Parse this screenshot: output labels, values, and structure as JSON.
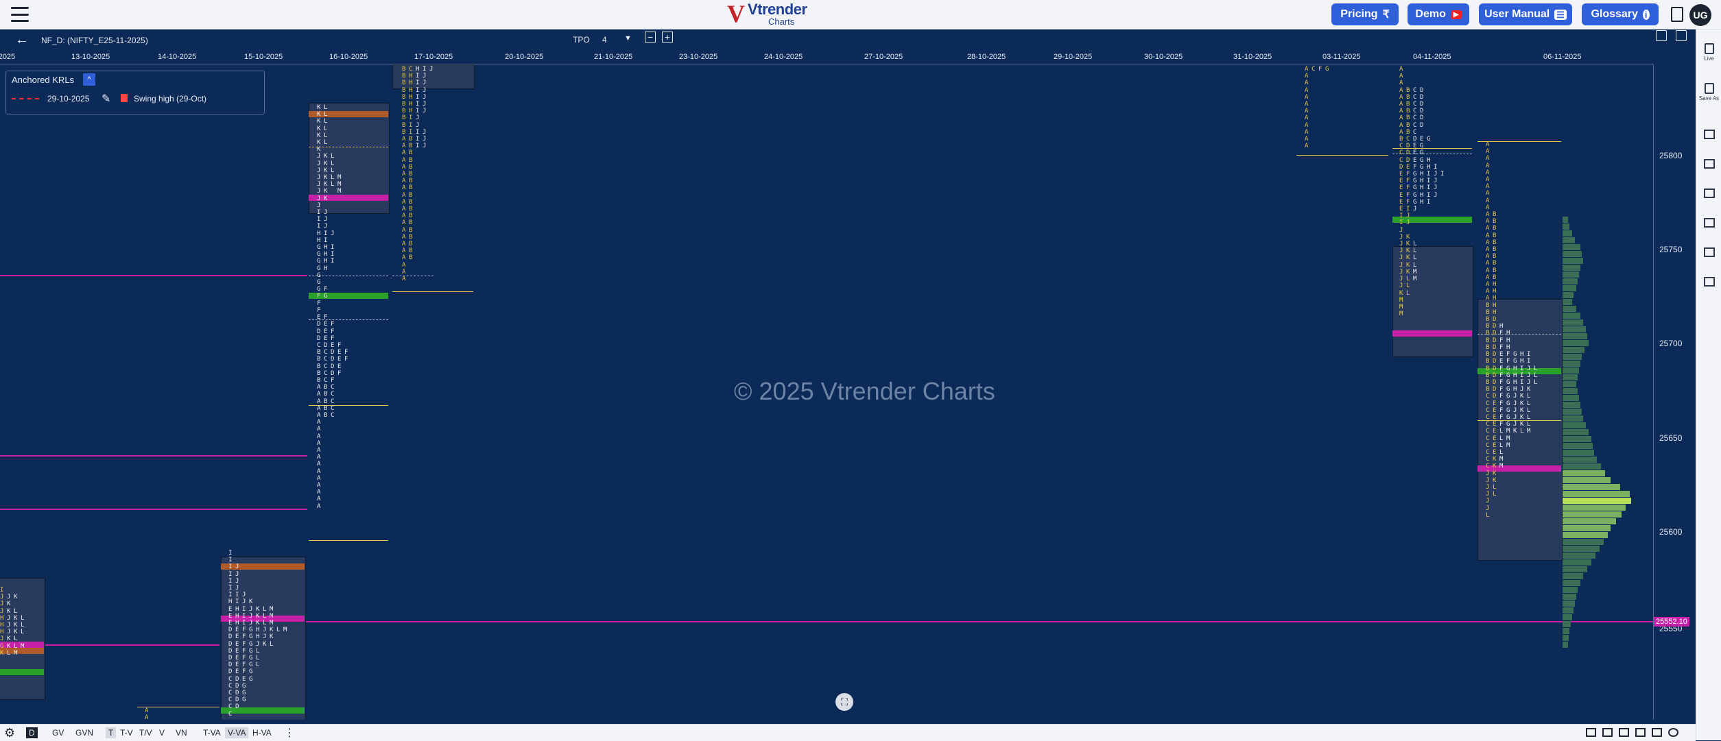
{
  "header": {
    "menu_icon": "hamburger-icon",
    "logo": {
      "mark": "V",
      "brand": "Vtrender",
      "sub": "Charts"
    },
    "buttons": [
      {
        "label": "Pricing",
        "icon": "₹",
        "icon_name": "rupee-icon"
      },
      {
        "label": "Demo",
        "icon": "▶",
        "icon_name": "youtube-icon"
      },
      {
        "label": "User Manual",
        "icon": "☰",
        "icon_name": "manual-icon"
      },
      {
        "label": "Glossary",
        "icon": "i",
        "icon_name": "info-icon"
      }
    ],
    "avatar": "UG",
    "accent": "#2f5fd9"
  },
  "chart": {
    "symbol": "NF_D: (NIFTY_E25-11-2025)",
    "tpo_label": "TPO",
    "tpo_value": "4",
    "dates": [
      "-2025",
      "13-10-2025",
      "14-10-2025",
      "15-10-2025",
      "16-10-2025",
      "17-10-2025",
      "20-10-2025",
      "21-10-2025",
      "23-10-2025",
      "24-10-2025",
      "27-10-2025",
      "28-10-2025",
      "29-10-2025",
      "30-10-2025",
      "31-10-2025",
      "03-11-2025",
      "04-11-2025",
      "06-11-2025"
    ],
    "price_labels": [
      "25800",
      "25750",
      "25700",
      "25650",
      "25600",
      "25550"
    ],
    "last_price": "25552.10",
    "watermark": "© 2025 Vtrender Charts",
    "colors": {
      "poc": "#c81fa8",
      "va_band": "#2aa12a",
      "ib_band": "#b05a2a",
      "bg": "#0c2a57",
      "profile": "#3a6e55"
    }
  },
  "krl": {
    "title": "Anchored KRLs",
    "collapse": "^",
    "date": "29-10-2025",
    "name": "Swing high (29-Oct)"
  },
  "profiles": [
    {
      "id": "p1",
      "cols": [
        {
          "c": "y",
          "t": "I\nJ\nJ\nJ\nH\nH\nH\nJ\nG\nK"
        },
        {
          "c": "w",
          "t": "\nJ\nK\nK\nJ\nJ\nJ\nK\nK\nL"
        },
        {
          "c": "w",
          "t": "\nK\n\nL\nK\nK\nK\nL\nL\nM"
        },
        {
          "c": "w",
          "t": "\n\n\n\nL\nL\nL\n\nM"
        }
      ]
    },
    {
      "id": "p2",
      "cols": [
        {
          "c": "y",
          "t": "A\nA"
        }
      ]
    },
    {
      "id": "p3",
      "cols": [
        {
          "c": "w",
          "t": "I\nI\nI\nI\nI\nI\nI\nH\nE\nE\nE\nD\nD\nD\nD\nD\nD\nD\nC\nC\nC\nC\nC\nC"
        },
        {
          "c": "w",
          "t": "\n\nJ\nJ\nJ\nJ\nI\nI\nH\nH\nH\nE\nE\nE\nE\nE\nE\nE\nD\nD\nD\nD\nD"
        },
        {
          "c": "w",
          "t": "\n\n\n\n\n\nJ\nJ\nI\nI\nI\nF\nF\nF\nF\nF\nF\nF\nE\nG\nG\nG"
        },
        {
          "c": "w",
          "t": "\n\n\n\n\n\n\nK\nJ\nJ\nJ\nG\nG\nG\nG\nG\nG\nG\nG"
        },
        {
          "c": "w",
          "t": "\n\n\n\n\n\n\n\nK\nK\nK\nH\nH\nJ\nL\nL\nL"
        },
        {
          "c": "w",
          "t": "\n\n\n\n\n\n\n\nL\nL\nL\nJ\nJ\nK"
        },
        {
          "c": "w",
          "t": "\n\n\n\n\n\n\n\nM\nM\nM\nK\nK\nL"
        },
        {
          "c": "w",
          "t": "\n\n\n\n\n\n\n\n\n\n\nL"
        },
        {
          "c": "w",
          "t": "\n\n\n\n\n\n\n\n\n\n\nM"
        }
      ]
    },
    {
      "id": "p4",
      "cols": [
        {
          "c": "w",
          "t": "K\nK\nK\nK\nK\nK\nK\nJ\nJ\nJ\nJ\nJ\nJ\nJ\nJ\nI\nI\nI\nH\nH\nG\nG\nG\nG\nG\nG\nG\nF\nF\nF\nE\nD\nD\nD\nC\nB\nB\nB\nB\nB\nA\nA\nA\nA\nA\nA\nA\nA\nA\nA\nA\nA\nA\nA\nA\nA\nA\nA"
        },
        {
          "c": "w",
          "t": "L\nL\nL\nL\nL\nL\n\nK\nK\nK\nK\nK\nK\nK\n\nJ\nJ\nJ\nI\nI\nH\nH\nH\nH\n\n\nF\nG\n\n\nF\nE\nE\nE\nD\nC\nC\nC\nC\nC\nB\nB\nB\nB\nB"
        },
        {
          "c": "w",
          "t": "\n\n\n\n\n\n\nL\nL\nL\nL\nL\n\n\n\n\n\n\nJ\n\nI\nI\nI\n\n\n\n\n\n\n\n\nF\nF\nF\nE\nD\nD\nD\nD\nF\nC\nC\nC\nC\nC"
        },
        {
          "c": "w",
          "t": "\n\n\n\n\n\n\n\n\n\nM\nM\nM\n\n\n\n\n\n\n\n\n\n\n\n\n\n\n\n\n\n\n\n\n\nF\nE\nE\nE\nF"
        },
        {
          "c": "w",
          "t": "\n\n\n\n\n\n\n\n\n\n\n\n\n\n\n\n\n\n\n\n\n\n\n\n\n\n\n\n\n\n\n\n\n\n\nF\nF"
        }
      ]
    },
    {
      "id": "p5",
      "cols": [
        {
          "c": "y",
          "t": "B\nB\nB\nB\nB\nB\nB\nB\nB\nB\nA\nA\nA\nA\nA\nA\nA\nA\nA\nA\nA\nA\nA\nA\nA\nA\nA\nA\nA\nA\nA"
        },
        {
          "c": "y",
          "t": "C\nH\nH\nH\nH\nH\nH\nI\nI\nI\nB\nB\nB\nB\nB\nB\nB\nB\nB\nB\nB\nB\nB\nB\nB\nB\nB\nB"
        },
        {
          "c": "w",
          "t": "H\nI\nI\nI\nI\nI\nI\nJ\nJ\nI\nI\nI"
        },
        {
          "c": "w",
          "t": "I\nJ\nJ\nJ\nJ\nJ\nJ\n\n\nJ\nJ\nJ"
        },
        {
          "c": "w",
          "t": "J"
        }
      ]
    },
    {
      "id": "p6",
      "cols": [
        {
          "c": "y",
          "t": "A\nA\nA\nA\nA\nA\nA\nA\nA\nA\nA\nA"
        },
        {
          "c": "y",
          "t": "C"
        },
        {
          "c": "y",
          "t": "F"
        },
        {
          "c": "y",
          "t": "G"
        }
      ]
    },
    {
      "id": "p7",
      "cols": [
        {
          "c": "y",
          "t": "A\nA\nA\nA\nA\nA\nA\nA\nA\nA\nB\nC\nC\nC\nD\nE\nE\nE\nE\nE\nE\nI\nI\nJ\nJ\nJ\nJ\nJ\nJ\nJ\nJ\nJ\nK\nM\nM\nM"
        },
        {
          "c": "y",
          "t": "\n\n\nB\nB\nB\nB\nB\nB\nB\nC\nD\nD\nD\nE\nF\nF\nF\nF\nF\nI\nJ\nJ\n\nK\nK\nK\nK\nK\nK\nL\nL\nL"
        },
        {
          "c": "w",
          "t": "\n\n\nC\nC\nC\nC\nC\nC\nC\nD\nE\nE\nE\nF\nG\nG\nG\nG\nG\nJ\n\n\n\n\nL\nL\nL\nL\nM\nM"
        },
        {
          "c": "w",
          "t": "\n\n\nD\nD\nD\nD\nD\nD\n\nE\nG\nG\nG\nG\nH\nH\nH\nH\nH"
        },
        {
          "c": "w",
          "t": "\n\n\n\n\n\n\n\n\n\nG\n\n\nH\nH\nI\nI\nI\nI\nI"
        },
        {
          "c": "w",
          "t": "\n\n\n\n\n\n\n\n\n\n\n\n\n\nI\nJ\nJ\nJ\nJ"
        },
        {
          "c": "w",
          "t": "\n\n\n\n\n\n\n\n\n\n\n\n\n\n\nI"
        }
      ]
    },
    {
      "id": "p8",
      "cols": [
        {
          "c": "y",
          "t": "A\nA\nA\nA\nA\nA\nA\nA\nA\nA\nA\nA\nA\nA\nA\nA\nA\nA\nA\nA\nA\nA\nA\nB\nB\nB\nB\nB\nB\nB\nB\nB\nB\nB\nB\nB\nC\nC\nC\nC\nC\nC\nC\nC\nC\nC\nC\nJ\nJ\nJ\nJ\nJ\nJ\nL"
        },
        {
          "c": "y",
          "t": "\n\n\n\n\n\n\n\n\n\nB\nB\nB\nB\nB\nB\nB\nB\nB\nB\nH\nH\nH\nH\nH\nD\nD\nD\nD\nD\nD\nD\nD\nD\nD\nD\nD\nE\nE\nE\nE\nE\nE\nE\nE\nK\nK\nK\nK\nL\nL"
        },
        {
          "c": "w",
          "t": "\n\n\n\n\n\n\n\n\n\n\n\n\n\n\n\n\n\n\n\n\n\n\n\n\n\nH\nF\nF\nF\nE\nE\nF\nF\nF\nF\nF\nF\nF\nF\nF\nL\nL\nL\nL\nM\nM"
        },
        {
          "c": "w",
          "t": "\n\n\n\n\n\n\n\n\n\n\n\n\n\n\n\n\n\n\n\n\n\n\n\n\n\n\nH\nH\nH\nF\nF\nG\nG\nG\nG\nG\nG\nG\nG\nG\nM\nM\nM"
        },
        {
          "c": "w",
          "t": "\n\n\n\n\n\n\n\n\n\n\n\n\n\n\n\n\n\n\n\n\n\n\n\n\n\n\n\n\n\nG\nG\nH\nH\nH\nH\nJ\nJ\nJ\nJ\nJ\nK"
        },
        {
          "c": "w",
          "t": "\n\n\n\n\n\n\n\n\n\n\n\n\n\n\n\n\n\n\n\n\n\n\n\n\n\n\n\n\n\nH\nH\nI\nI\nI\nJ\nK\nK\nK\nK\nK\nL"
        },
        {
          "c": "w",
          "t": "\n\n\n\n\n\n\n\n\n\n\n\n\n\n\n\n\n\n\n\n\n\n\n\n\n\n\n\n\n\nI\nI\nJ\nJ\nJ\nK\nL\nL\nL\nL\nL\nM"
        },
        {
          "c": "w",
          "t": "\n\n\n\n\n\n\n\n\n\n\n\n\n\n\n\n\n\n\n\n\n\n\n\n\n\n\n\n\n\n\n\nL\nL\nL"
        }
      ]
    }
  ],
  "bottom": {
    "tabs": [
      "D",
      "GV",
      "GVN",
      "T",
      "T-V",
      "T/V",
      "V",
      "VN",
      "T-VA",
      "V-VA",
      "H-VA"
    ],
    "active": "D",
    "selected": "V-VA"
  },
  "sidebar": {
    "items": [
      {
        "label": "Live"
      },
      {
        "label": "Save As"
      }
    ]
  }
}
